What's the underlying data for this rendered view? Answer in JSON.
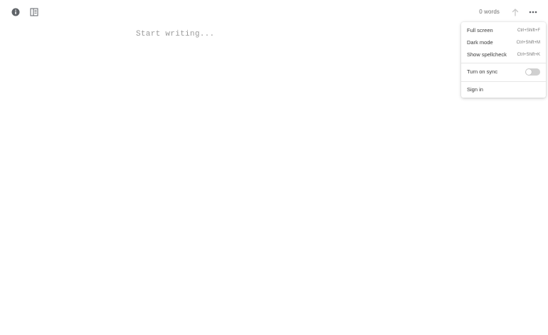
{
  "toolbar": {
    "info_icon": "info-icon",
    "sidebar_icon": "sidebar-icon",
    "word_count": "0 words",
    "share_icon": "upload-arrow-icon",
    "more_icon": "ellipsis-icon"
  },
  "editor": {
    "placeholder": "Start writing...",
    "value": ""
  },
  "menu": {
    "items": [
      {
        "label": "Full screen",
        "shortcut": "Ctrl+Shift+F"
      },
      {
        "label": "Dark mode",
        "shortcut": "Ctrl+Shift+M"
      },
      {
        "label": "Show spellcheck",
        "shortcut": "Ctrl+Shift+K"
      }
    ],
    "sync": {
      "label": "Turn on sync",
      "enabled": false
    },
    "sign_in": {
      "label": "Sign in"
    }
  },
  "colors": {
    "icon": "#5f6368",
    "icon_disabled": "#c8c8c8",
    "toggle_off": "#d0d0d0"
  }
}
